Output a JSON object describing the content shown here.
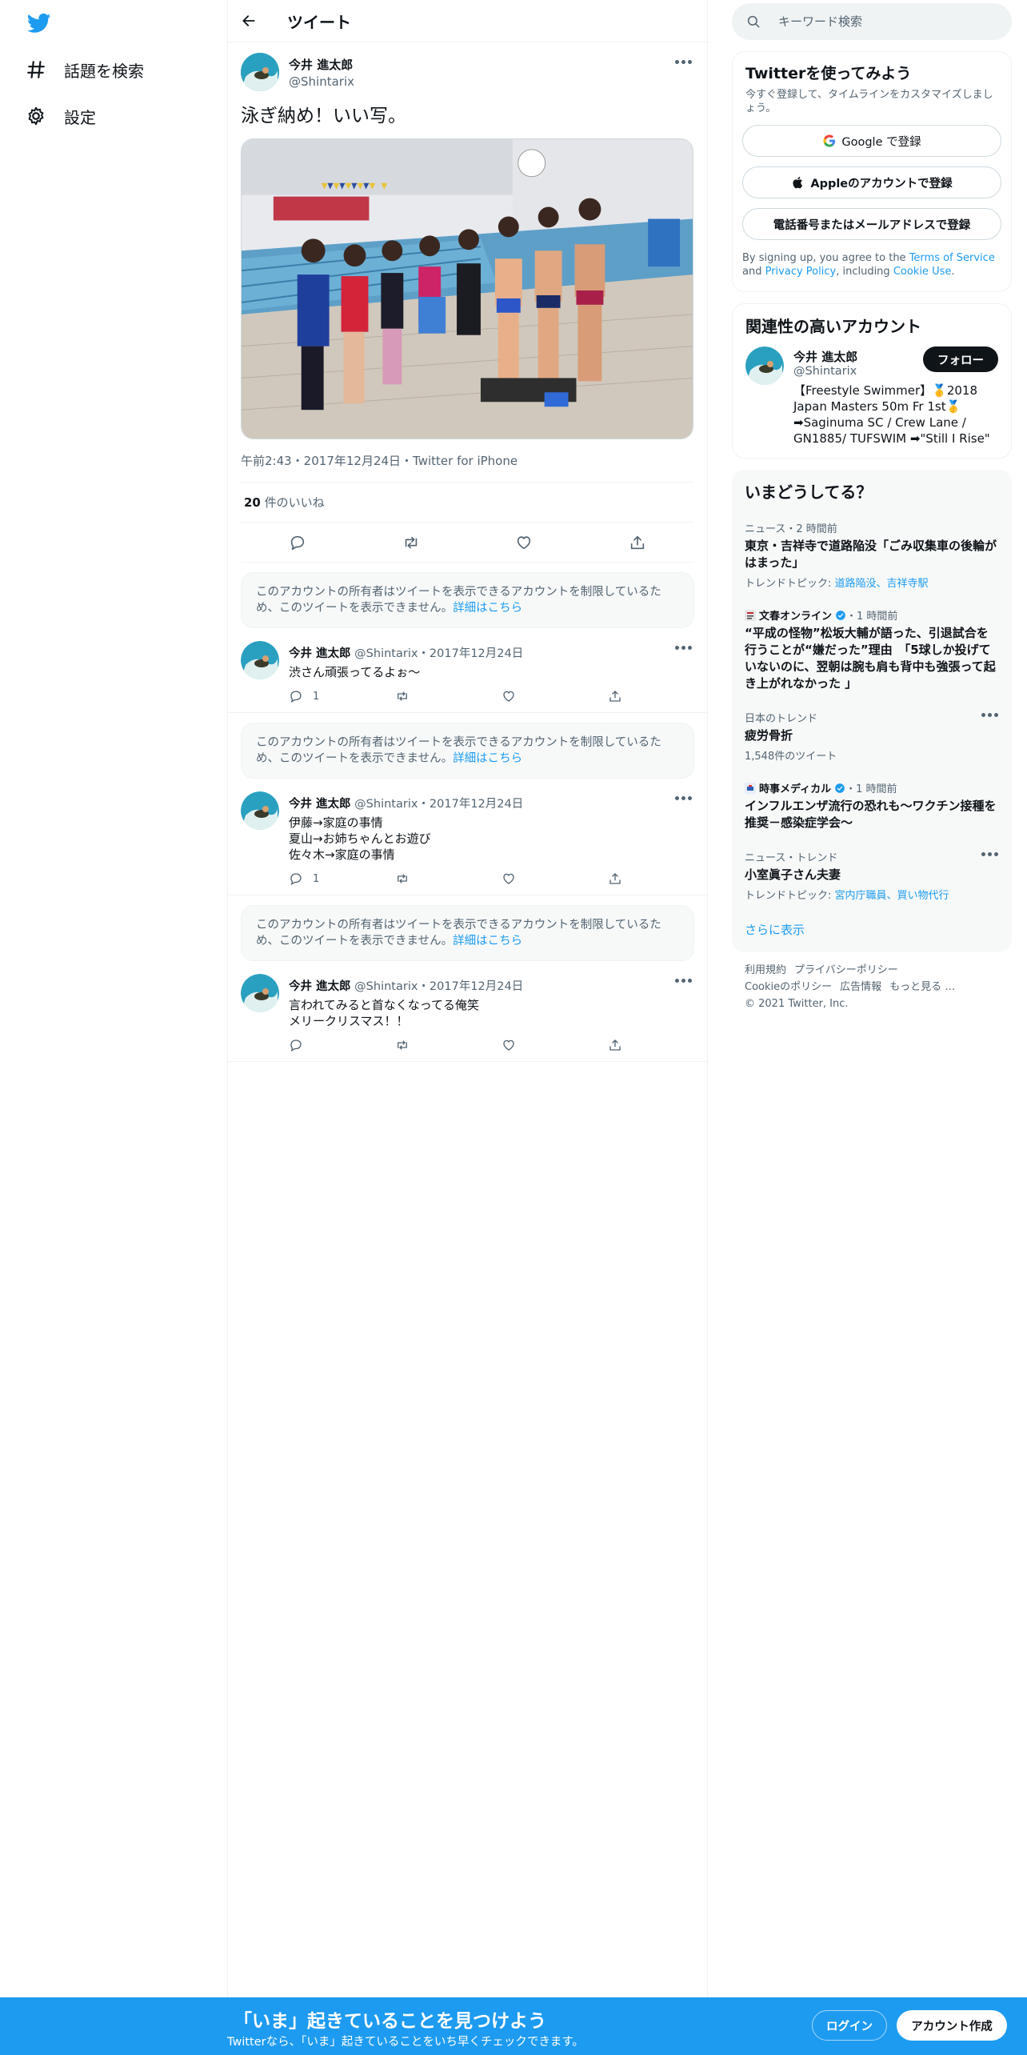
{
  "colors": {
    "brand": "#1d9bf0",
    "text": "#0f1419",
    "muted": "#536471",
    "border": "#eff3f4"
  },
  "nav": {
    "logo_icon": "twitter-bird-icon",
    "items": [
      {
        "icon": "hashtag-icon",
        "label": "話題を検索"
      },
      {
        "icon": "gear-icon",
        "label": "設定"
      }
    ]
  },
  "header": {
    "back_icon": "arrow-left-icon",
    "title": "ツイート"
  },
  "focal_tweet": {
    "name": "今井 進太郎",
    "handle": "@Shintarix",
    "text": "泳ぎ納め！いい写。",
    "meta": "午前2:43・2017年12月24日・Twitter for iPhone",
    "likes_count": "20",
    "likes_label": " 件のいいね"
  },
  "restricted": {
    "text": "このアカウントの所有者はツイートを表示できるアカウントを制限しているため、このツイートを表示できません。",
    "link": "詳細はこちら"
  },
  "replies": [
    {
      "name": "今井 進太郎",
      "handle_date": "@Shintarix・2017年12月24日",
      "lines": [
        "渋さん頑張ってるよぉ〜"
      ],
      "replies": "1"
    },
    {
      "name": "今井 進太郎",
      "handle_date": "@Shintarix・2017年12月24日",
      "lines": [
        "伊藤→家庭の事情",
        "夏山→お姉ちゃんとお遊び",
        "佐々木→家庭の事情"
      ],
      "replies": "1"
    },
    {
      "name": "今井 進太郎",
      "handle_date": "@Shintarix・2017年12月24日",
      "lines": [
        "言われてみると首なくなってる俺笑",
        "メリークリスマス！！"
      ],
      "replies": ""
    }
  ],
  "search": {
    "placeholder": "キーワード検索"
  },
  "signup": {
    "title": "Twitterを使ってみよう",
    "subtitle": "今すぐ登録して、タイムラインをカスタマイズしましょう。",
    "google": "Google で登録",
    "apple": "Appleのアカウントで登録",
    "phone": "電話番号またはメールアドレスで登録",
    "terms_prefix": "By signing up, you agree to the ",
    "terms_link": "Terms of Service",
    "terms_and": " and ",
    "privacy_link": "Privacy Policy",
    "terms_including": ", including ",
    "cookie_link": "Cookie Use",
    "terms_end": "."
  },
  "relevant": {
    "title": "関連性の高いアカウント",
    "name": "今井 進太郎",
    "handle": "@Shintarix",
    "follow": "フォロー",
    "bio": "【Freestyle Swimmer】🥇2018 Japan Masters 50m Fr 1st🥇 ➡Saginuma SC / Crew Lane / GN1885/ TUFSWIM ➡\"Still I Rise\""
  },
  "trends": {
    "title": "いまどうしてる？",
    "items": [
      {
        "meta": "ニュース・2 時間前",
        "title": "東京・吉祥寺で道路陥没「ごみ収集車の後輪がはまった」",
        "sub_prefix": "トレンドトピック: ",
        "sub_links": "道路陥没、吉祥寺駅"
      },
      {
        "source": "文春オンライン",
        "time": "・1 時間前",
        "title": "“平成の怪物”松坂大輔が語った、引退試合を行うことが“嫌だった”理由　「5球しか投げていないのに、翌朝は腕も肩も背中も強張って起き上がれなかった 」"
      },
      {
        "meta": "日本のトレンド",
        "title": "疲労骨折",
        "sub": "1,548件のツイート"
      },
      {
        "source": "時事メディカル",
        "time": "・1 時間前",
        "title": "インフルエンザ流行の恐れも～ワクチン接種を推奨－感染症学会～"
      },
      {
        "meta": "ニュース・トレンド",
        "title": "小室眞子さん夫妻",
        "sub_prefix": "トレンドトピック: ",
        "sub_links": "宮内庁職員、買い物代行"
      }
    ],
    "show_more": "さらに表示"
  },
  "footer": {
    "links1": [
      "利用規約",
      "プライバシーポリシー"
    ],
    "links2": [
      "Cookieのポリシー",
      "広告情報",
      "もっと見る …"
    ],
    "copyright": "© 2021 Twitter, Inc."
  },
  "bottom": {
    "headline": "「いま」起きていることを見つけよう",
    "sub": "Twitterなら、「いま」起きていることをいち早くチェックできます。",
    "login": "ログイン",
    "signup": "アカウント作成"
  }
}
